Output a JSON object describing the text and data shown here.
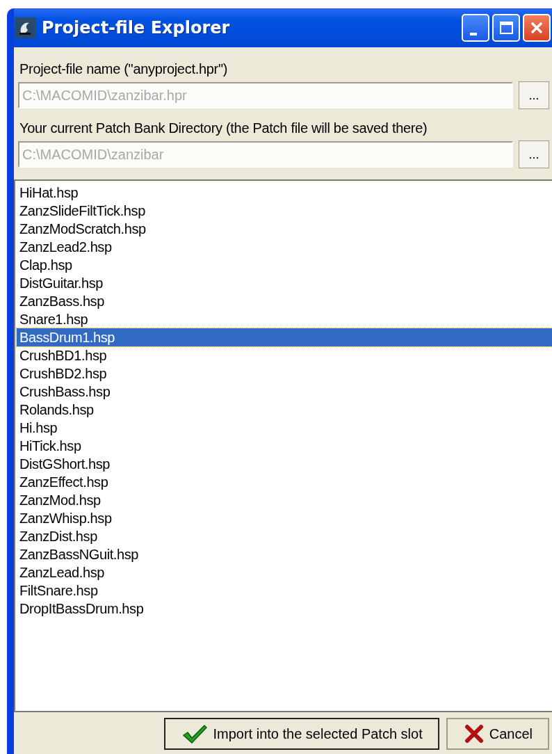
{
  "window": {
    "title": "Project-file Explorer"
  },
  "fields": [
    {
      "label": "Project-file name (\"anyproject.hpr\")",
      "value": "C:\\MACOMID\\zanzibar.hpr",
      "disabled": true,
      "browse": "..."
    },
    {
      "label": "Your current Patch Bank Directory (the Patch file will be saved there)",
      "value": "C:\\MACOMID\\zanzibar",
      "disabled": true,
      "browse": "..."
    }
  ],
  "files": [
    {
      "name": "HiHat.hsp",
      "selected": false
    },
    {
      "name": "ZanzSlideFiltTick.hsp",
      "selected": false
    },
    {
      "name": "ZanzModScratch.hsp",
      "selected": false
    },
    {
      "name": "ZanzLead2.hsp",
      "selected": false
    },
    {
      "name": "Clap.hsp",
      "selected": false
    },
    {
      "name": "DistGuitar.hsp",
      "selected": false
    },
    {
      "name": "ZanzBass.hsp",
      "selected": false
    },
    {
      "name": "Snare1.hsp",
      "selected": false
    },
    {
      "name": "BassDrum1.hsp",
      "selected": true
    },
    {
      "name": "CrushBD1.hsp",
      "selected": false
    },
    {
      "name": "CrushBD2.hsp",
      "selected": false
    },
    {
      "name": "CrushBass.hsp",
      "selected": false
    },
    {
      "name": "Rolands.hsp",
      "selected": false
    },
    {
      "name": "Hi.hsp",
      "selected": false
    },
    {
      "name": "HiTick.hsp",
      "selected": false
    },
    {
      "name": "DistGShort.hsp",
      "selected": false
    },
    {
      "name": "ZanzEffect.hsp",
      "selected": false
    },
    {
      "name": "ZanzMod.hsp",
      "selected": false
    },
    {
      "name": "ZanzWhisp.hsp",
      "selected": false
    },
    {
      "name": "ZanzDist.hsp",
      "selected": false
    },
    {
      "name": "ZanzBassNGuit.hsp",
      "selected": false
    },
    {
      "name": "ZanzLead.hsp",
      "selected": false
    },
    {
      "name": "FiltSnare.hsp",
      "selected": false
    },
    {
      "name": "DropItBassDrum.hsp",
      "selected": false
    }
  ],
  "buttons": [
    {
      "kind": "import",
      "label": "Import into the selected Patch slot"
    },
    {
      "kind": "cancel",
      "label": "Cancel"
    }
  ]
}
